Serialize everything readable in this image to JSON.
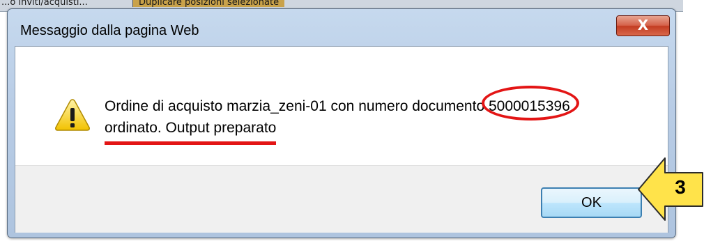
{
  "background": {
    "left_text": "...o inviti/acquisti...",
    "right_text": "Duplicare posizioni selezionate"
  },
  "dialog": {
    "title": "Messaggio dalla pagina Web",
    "close_label": "X",
    "message_part1": "Ordine di acquisto marzia_zeni-01 con numero documento ",
    "document_number": "5000015396",
    "message_part2": "ordinato. Output preparato",
    "ok_label": "OK",
    "icon": "warning-icon"
  },
  "annotation": {
    "step_number": "3",
    "highlight_color": "#e31515",
    "arrow_fill": "#ffe34a"
  }
}
